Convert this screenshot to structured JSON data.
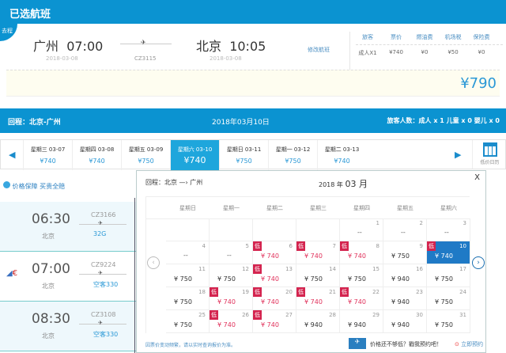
{
  "header": {
    "title": "已选航班"
  },
  "outbound": {
    "tag": "去程",
    "from_city": "广州",
    "from_time": "07:00",
    "from_date": "2018-03-08",
    "flight": "CZ3115",
    "to_city": "北京",
    "to_time": "10:05",
    "to_date": "2018-03-08",
    "modify": "修改航班",
    "fees": {
      "headers": [
        "旅客",
        "票价",
        "燃油费",
        "机场税",
        "保险费"
      ],
      "values": [
        "成人X1",
        "¥740",
        "¥0",
        "¥50",
        "¥0"
      ]
    },
    "total": "¥790"
  },
  "return": {
    "route": "回程：北京-广州",
    "date": "2018年03月10日",
    "passengers": "旅客人数：成人 x 1   儿童 x 0   婴儿 x 0"
  },
  "strip": {
    "days": [
      {
        "label": "星期三 03-07",
        "price": "¥740"
      },
      {
        "label": "星期四 03-08",
        "price": "¥740"
      },
      {
        "label": "星期五 03-09",
        "price": "¥750"
      },
      {
        "label": "星期六 03-10",
        "price": "¥740",
        "selected": true
      },
      {
        "label": "星期日 03-11",
        "price": "¥750"
      },
      {
        "label": "星期一 03-12",
        "price": "¥750"
      },
      {
        "label": "星期二 03-13",
        "price": "¥740"
      }
    ],
    "calendar_label": "低价日历"
  },
  "guarantee": "价格保障 买贵全赔",
  "flights": [
    {
      "time": "06:30",
      "city": "北京",
      "flight": "CZ3166",
      "plane": "32G"
    },
    {
      "time": "07:00",
      "city": "北京",
      "flight": "CZ9224",
      "plane": "空客330",
      "logo": true
    },
    {
      "time": "08:30",
      "city": "北京",
      "flight": "CZ3108",
      "plane": "空客330"
    }
  ],
  "calendar": {
    "route": "回程：北京 —› 广州",
    "year": "2018 年",
    "month": "03 月",
    "close": "X",
    "low_label": "低",
    "weekdays": [
      "星期日",
      "星期一",
      "星期二",
      "星期三",
      "星期四",
      "星期五",
      "星期六"
    ],
    "first_weekday": 4,
    "days": [
      {
        "d": "1",
        "p": "--"
      },
      {
        "d": "2",
        "p": "--"
      },
      {
        "d": "3",
        "p": "--"
      },
      {
        "d": "4",
        "p": "--"
      },
      {
        "d": "5",
        "p": "--"
      },
      {
        "d": "6",
        "p": "¥ 740",
        "low": true
      },
      {
        "d": "7",
        "p": "¥ 740",
        "low": true
      },
      {
        "d": "8",
        "p": "¥ 740",
        "low": true
      },
      {
        "d": "9",
        "p": "¥ 750"
      },
      {
        "d": "10",
        "p": "¥ 740",
        "low": true,
        "selected": true
      },
      {
        "d": "11",
        "p": "¥ 750"
      },
      {
        "d": "12",
        "p": "¥ 750"
      },
      {
        "d": "13",
        "p": "¥ 740",
        "low": true
      },
      {
        "d": "14",
        "p": "¥ 750"
      },
      {
        "d": "15",
        "p": "¥ 750"
      },
      {
        "d": "16",
        "p": "¥ 940"
      },
      {
        "d": "17",
        "p": "¥ 750"
      },
      {
        "d": "18",
        "p": "¥ 750"
      },
      {
        "d": "19",
        "p": "¥ 740",
        "low": true
      },
      {
        "d": "20",
        "p": "¥ 740",
        "low": true
      },
      {
        "d": "21",
        "p": "¥ 740",
        "low": true
      },
      {
        "d": "22",
        "p": "¥ 740",
        "low": true
      },
      {
        "d": "23",
        "p": "¥ 940"
      },
      {
        "d": "24",
        "p": "¥ 750"
      },
      {
        "d": "25",
        "p": "¥ 750"
      },
      {
        "d": "26",
        "p": "¥ 740",
        "low": true
      },
      {
        "d": "27",
        "p": "¥ 740",
        "low": true
      },
      {
        "d": "28",
        "p": "¥ 940"
      },
      {
        "d": "29",
        "p": "¥ 940"
      },
      {
        "d": "30",
        "p": "¥ 940"
      },
      {
        "d": "31",
        "p": "¥ 750"
      }
    ],
    "note": "因票价变动频繁，请以实时查询报价为准。",
    "promo": "价格还不够低？戳我预约吧！",
    "book": "立即预约"
  },
  "colors": {
    "primary": "#0b93d1",
    "low": "#d4244f",
    "selected": "#1f7ac6"
  }
}
